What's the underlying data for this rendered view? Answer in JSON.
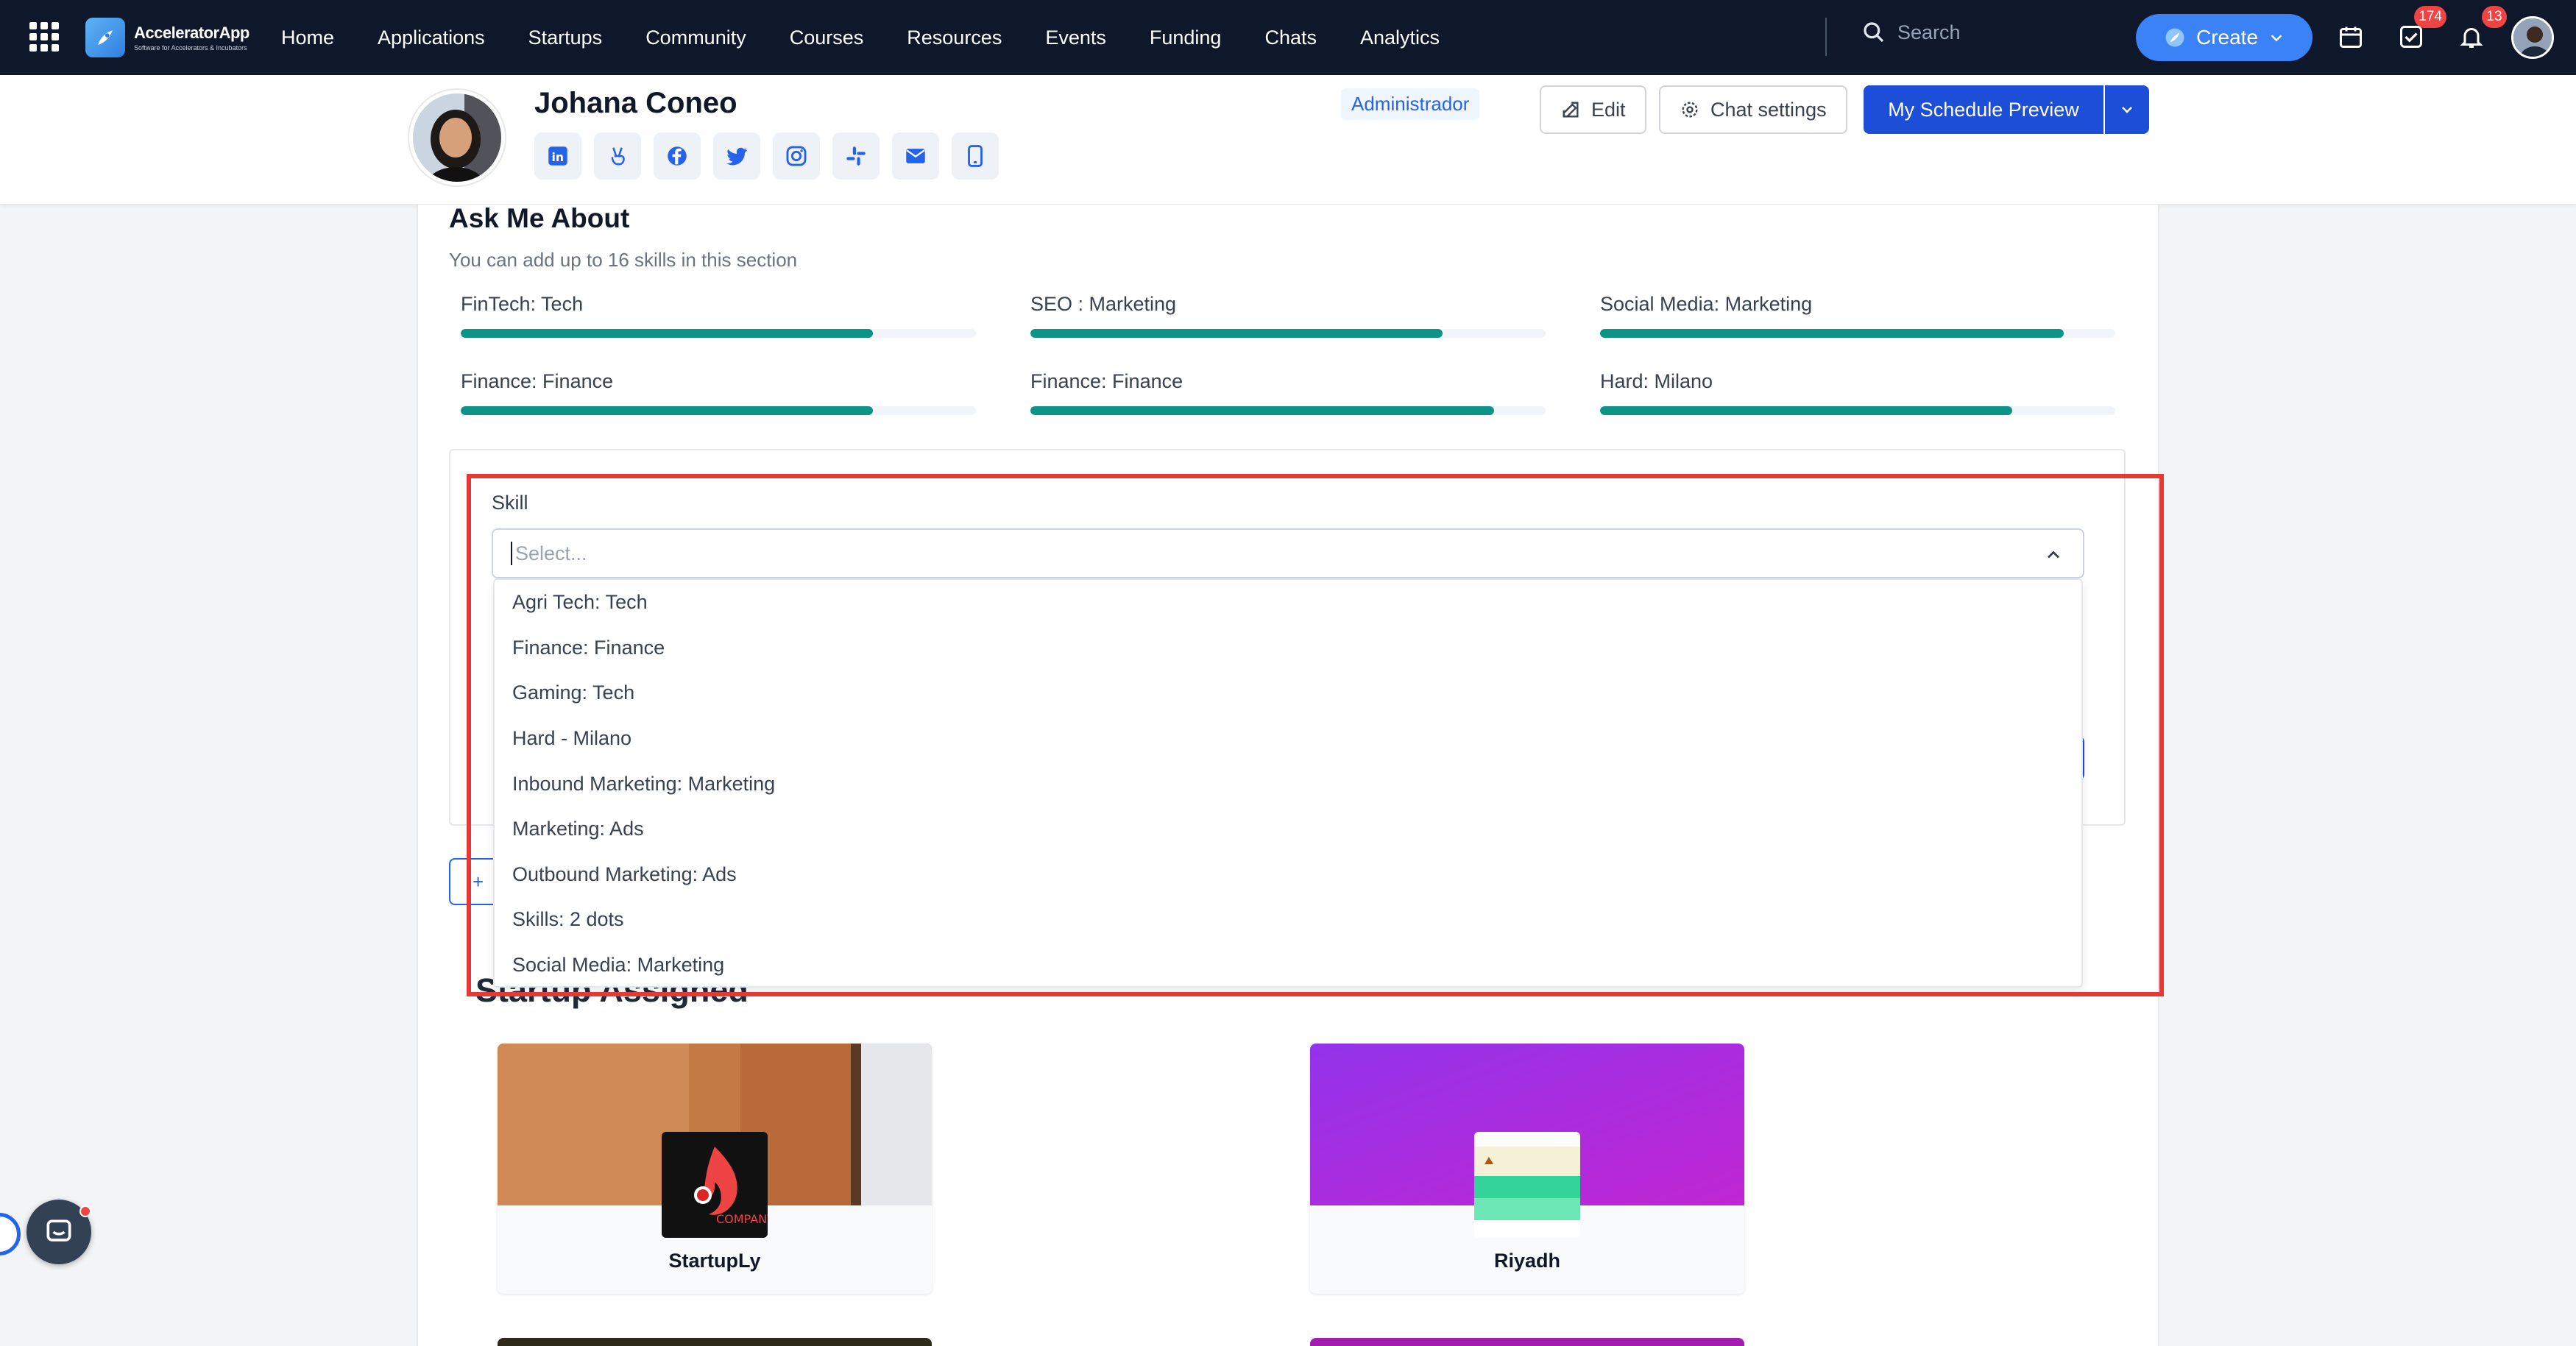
{
  "nav": {
    "logo_title": "AcceleratorApp",
    "logo_tagline": "Software for Accelerators & Incubators",
    "links": [
      "Home",
      "Applications",
      "Startups",
      "Community",
      "Courses",
      "Resources",
      "Events",
      "Funding",
      "Chats",
      "Analytics"
    ],
    "search_placeholder": "Search",
    "create_label": "Create",
    "tasks_badge": "174",
    "notifications_badge": "13"
  },
  "profile": {
    "name": "Johana Coneo",
    "role": "Administrador",
    "edit_label": "Edit",
    "chat_settings_label": "Chat settings",
    "schedule_label": "My Schedule Preview",
    "socials": [
      "linkedin-icon",
      "angellist-icon",
      "facebook-icon",
      "twitter-icon",
      "instagram-icon",
      "slack-icon",
      "email-icon",
      "phone-icon"
    ]
  },
  "ask_me_about": {
    "title": "Ask Me About",
    "subtitle": "You can add up to 16 skills in this section",
    "skills": [
      {
        "label": "FinTech: Tech",
        "level": 0.8
      },
      {
        "label": "SEO : Marketing",
        "level": 0.8
      },
      {
        "label": "Social Media: Marketing",
        "level": 0.9
      },
      {
        "label": "Finance: Finance",
        "level": 0.8
      },
      {
        "label": "Finance: Finance",
        "level": 0.9
      },
      {
        "label": "Hard: Milano",
        "level": 0.8
      }
    ]
  },
  "skill_form": {
    "label": "Skill",
    "placeholder": "Select...",
    "options": [
      "Agri Tech: Tech",
      "Finance: Finance",
      "Gaming: Tech",
      "Hard - Milano",
      "Inbound Marketing: Marketing",
      "Marketing: Ads",
      "Outbound Marketing: Ads",
      "Skills: 2 dots",
      "Social Media: Marketing"
    ],
    "add_label": "+"
  },
  "startups": {
    "title": "Startup Assigned",
    "items": [
      {
        "name": "StartupLy",
        "logo_text": "COMPANY"
      },
      {
        "name": "Riyadh"
      }
    ]
  },
  "colors": {
    "nav_bg": "#0f172a",
    "accent": "#1d4ed8",
    "progress": "#0d9488",
    "highlight": "#e53935"
  }
}
